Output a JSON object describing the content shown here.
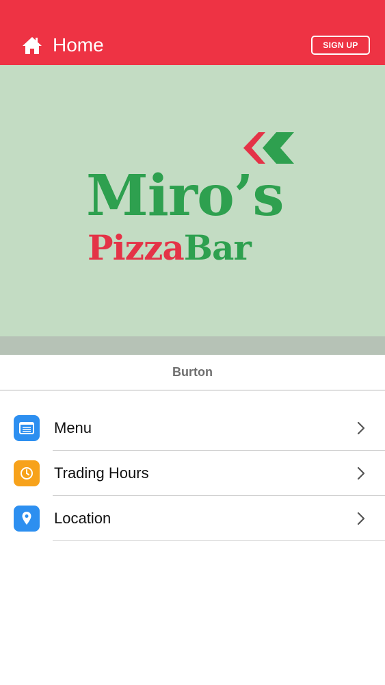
{
  "header": {
    "title": "Home",
    "icon": "home-icon",
    "signup_label": "SIGN UP",
    "background": "#ee3344"
  },
  "hero": {
    "background": "#c3dcc3",
    "logo": {
      "line1": "Miro’s",
      "line2_part1": "Pizza",
      "line2_part2": "Bar",
      "green": "#2ea04f",
      "red": "#e43347"
    }
  },
  "location": {
    "name": "Burton"
  },
  "menu_items": [
    {
      "label": "Menu",
      "icon": "menu-list-icon",
      "icon_color": "#2d8ff0"
    },
    {
      "label": "Trading Hours",
      "icon": "clock-icon",
      "icon_color": "#f7a21b"
    },
    {
      "label": "Location",
      "icon": "map-pin-icon",
      "icon_color": "#2d8ff0"
    }
  ]
}
